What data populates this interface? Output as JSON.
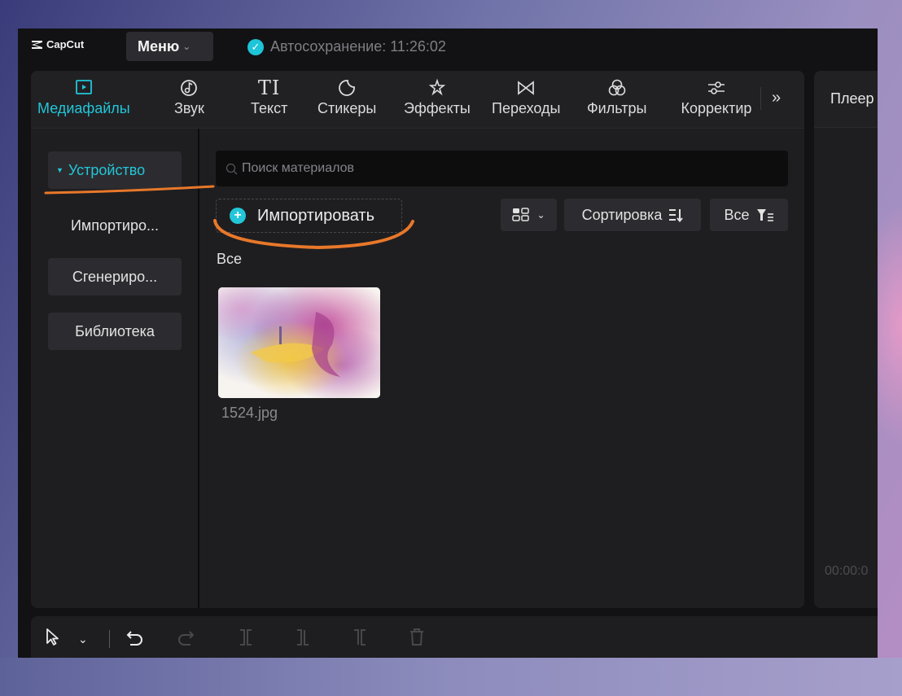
{
  "app": {
    "logo_text": "CapCut",
    "menu_label": "Меню",
    "autosave_text": "Автосохранение: 11:26:02"
  },
  "tabs": [
    {
      "label": "Медиафайлы",
      "icon": "media-icon",
      "active": true
    },
    {
      "label": "Звук",
      "icon": "audio-icon"
    },
    {
      "label": "Текст",
      "icon": "text-icon",
      "glyph": "TI"
    },
    {
      "label": "Стикеры",
      "icon": "sticker-icon"
    },
    {
      "label": "Эффекты",
      "icon": "effects-icon"
    },
    {
      "label": "Переходы",
      "icon": "transitions-icon"
    },
    {
      "label": "Фильтры",
      "icon": "filters-icon"
    },
    {
      "label": "Корректир",
      "icon": "adjust-icon"
    }
  ],
  "more_label": "»",
  "sidebar": {
    "items": [
      {
        "label": "Устройство",
        "active": true
      },
      {
        "label": "Импортиро..."
      },
      {
        "label": "Сгенериро..."
      },
      {
        "label": "Библиотека"
      }
    ]
  },
  "search": {
    "placeholder": "Поиск материалов"
  },
  "toolbar": {
    "import_label": "Импортировать",
    "sort_label": "Сортировка",
    "filter_label": "Все"
  },
  "section_label": "Все",
  "media": [
    {
      "file_name": "1524.jpg"
    }
  ],
  "player": {
    "title": "Плеер",
    "time": "00:00:0"
  },
  "colors": {
    "accent": "#22c6d8",
    "annotation": "#e8782a"
  }
}
